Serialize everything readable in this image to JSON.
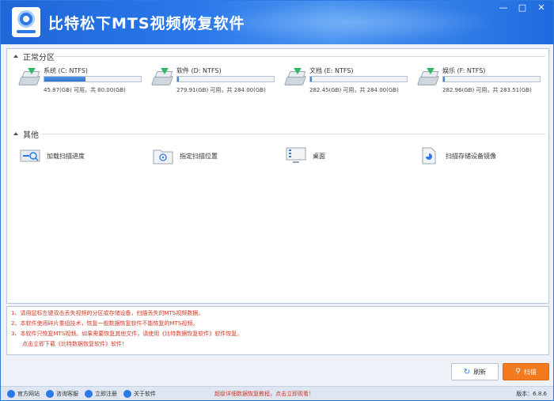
{
  "window": {
    "title": "比特松下MTS视频恢复软件",
    "min_label": "—",
    "max_label": "□",
    "close_label": "✕"
  },
  "partitions": {
    "header": "正常分区",
    "drives": [
      {
        "name": "系统 (C: NTFS)",
        "capacity": "45.87(GB) 可用，共 80.00(GB)",
        "used_fraction": 0.43,
        "icon": "drive-icon"
      },
      {
        "name": "软件 (D: NTFS)",
        "capacity": "279.91(GB) 可用，共 284.00(GB)",
        "used_fraction": 0.01,
        "icon": "drive-icon"
      },
      {
        "name": "文档 (E: NTFS)",
        "capacity": "282.45(GB) 可用，共 284.00(GB)",
        "used_fraction": 0.005,
        "icon": "drive-icon"
      },
      {
        "name": "娱乐 (F: NTFS)",
        "capacity": "282.96(GB) 可用，共 283.51(GB)",
        "used_fraction": 0.002,
        "icon": "drive-icon"
      }
    ]
  },
  "others": {
    "header": "其他",
    "items": [
      {
        "label": "加载扫描进度",
        "icon": "load-progress-icon"
      },
      {
        "label": "指定扫描位置",
        "icon": "folder-target-icon"
      },
      {
        "label": "桌面",
        "icon": "desktop-icon"
      },
      {
        "label": "扫描存储设备镜像",
        "icon": "image-file-icon"
      }
    ]
  },
  "notes": [
    "1、请用鼠标左键双击丢失视频的分区或存储设备，扫描丢失的MTS视频数据。",
    "2、本软件使用碎片重组技术，恢复一般数据恢复软件不能恢复的MTS视频。",
    "3、本软件只恢复MTS视频。如果需要恢复其他文件，请使用《比特数据恢复软件》软件恢复。",
    "　　点击立即下载《比特数据恢复软件》软件！"
  ],
  "buttons": {
    "refresh": "刷新",
    "scan": "扫描"
  },
  "statusbar": {
    "items": [
      "官方网站",
      "咨询客服",
      "立即注册",
      "关于软件"
    ],
    "promo": "超级详细数据恢复教程，点击立即观看！",
    "version": "版本：6.8.6"
  },
  "colors": {
    "accent": "#2a78ea",
    "warning_text": "#d23a2a",
    "scan_button": "#f27a1f"
  }
}
